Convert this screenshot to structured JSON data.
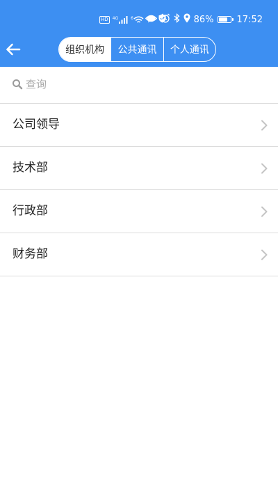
{
  "statusbar": {
    "hd": "HD",
    "signal_tag": "4G",
    "wifi_tag": "6",
    "battery_percent": "86%",
    "battery_level": 0.86,
    "time": "17:52"
  },
  "header": {
    "tabs": [
      {
        "label": "组织机构",
        "active": true
      },
      {
        "label": "公共通讯",
        "active": false
      },
      {
        "label": "个人通讯",
        "active": false
      }
    ]
  },
  "search": {
    "placeholder": "查询",
    "value": ""
  },
  "list": {
    "items": [
      {
        "label": "公司领导"
      },
      {
        "label": "技术部"
      },
      {
        "label": "行政部"
      },
      {
        "label": "财务部"
      }
    ]
  },
  "colors": {
    "header_bg": "#3d8ff2",
    "divider": "#dcdcdc",
    "chevron": "#c4c4c4",
    "placeholder": "#aaaaaa"
  },
  "icons": {
    "back": "arrow-left-icon",
    "search": "search-icon",
    "chevron": "chevron-right-icon"
  }
}
